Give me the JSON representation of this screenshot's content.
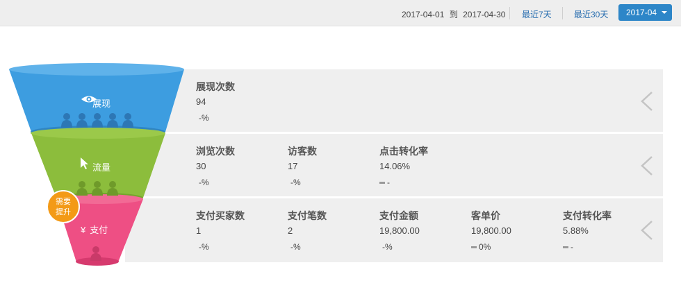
{
  "header": {
    "date_start": "2017-04-01",
    "date_to": "到",
    "date_end": "2017-04-30",
    "last7_label": "最近7天",
    "last30_label": "最近30天",
    "month_label": "2017-04"
  },
  "colors": {
    "exposure": "#3d9de0",
    "traffic": "#8cbd3c",
    "payment": "#ee4f84",
    "badge": "#f39a16",
    "accent": "#2d86c8"
  },
  "funnel": {
    "stages": [
      {
        "name": "展现",
        "icon": "eye-icon"
      },
      {
        "name": "流量",
        "icon": "cursor-icon"
      },
      {
        "name": "支付",
        "icon": "yuan-icon"
      }
    ],
    "badge_line1": "需要",
    "badge_line2": "提升"
  },
  "rows": [
    {
      "metrics": [
        {
          "label": "展现次数",
          "value": "94",
          "change": "-%",
          "change_icon": ""
        }
      ]
    },
    {
      "metrics": [
        {
          "label": "浏览次数",
          "value": "30",
          "change": "-%",
          "change_icon": ""
        },
        {
          "label": "访客数",
          "value": "17",
          "change": "-%",
          "change_icon": ""
        },
        {
          "label": "点击转化率",
          "value": "14.06%",
          "change": "-",
          "change_icon": "flat-dash-icon"
        }
      ]
    },
    {
      "metrics": [
        {
          "label": "支付买家数",
          "value": "1",
          "change": "-%",
          "change_icon": ""
        },
        {
          "label": "支付笔数",
          "value": "2",
          "change": "-%",
          "change_icon": ""
        },
        {
          "label": "支付金额",
          "value": "19,800.00",
          "change": "-%",
          "change_icon": ""
        },
        {
          "label": "客单价",
          "value": "19,800.00",
          "change": "0%",
          "change_icon": "flat-dash-icon"
        },
        {
          "label": "支付转化率",
          "value": "5.88%",
          "change": "-",
          "change_icon": "flat-dash-icon"
        }
      ]
    }
  ]
}
